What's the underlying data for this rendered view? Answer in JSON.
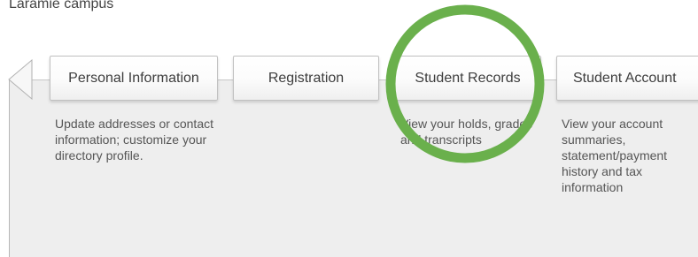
{
  "header": {
    "campus_label": "Laramie campus"
  },
  "nav": {
    "prev_icon": "chevron-left-icon",
    "tabs": [
      {
        "label": "Personal Information",
        "description": "Update addresses or contact information; customize your directory profile."
      },
      {
        "label": "Registration",
        "description": ""
      },
      {
        "label": "Student Records",
        "description": "View your holds, grades and transcripts"
      },
      {
        "label": "Student Account",
        "description": "View your account summaries, statement/payment history and tax information"
      }
    ]
  },
  "annotation": {
    "highlight_color": "#6ab04c",
    "highlight_target": "Student Records"
  }
}
